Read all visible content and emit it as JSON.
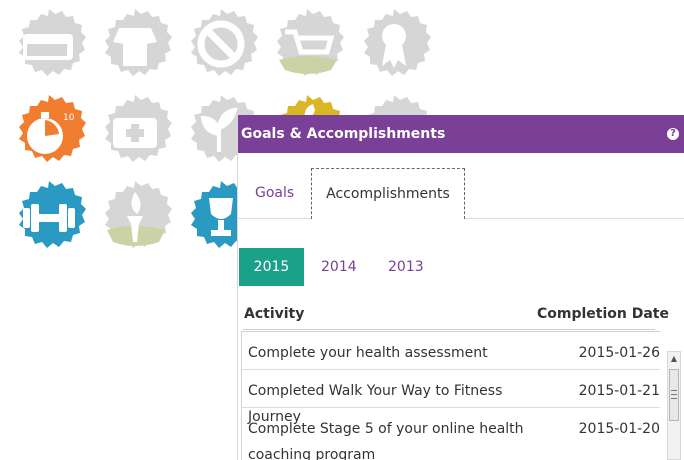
{
  "panel": {
    "title": "Goals & Accomplishments",
    "help": "?",
    "tabs": [
      {
        "label": "Goals"
      },
      {
        "label": "Accomplishments",
        "active": true
      }
    ],
    "years": [
      {
        "label": "2015",
        "active": true
      },
      {
        "label": "2014"
      },
      {
        "label": "2013"
      }
    ],
    "table": {
      "headers": {
        "activity": "Activity",
        "date": "Completion Date"
      },
      "rows": [
        {
          "activity": "Complete your health assessment",
          "date": "2015-01-26"
        },
        {
          "activity": "Completed Walk Your Way to Fitness Journey",
          "date": "2015-01-21"
        },
        {
          "activity": "Complete Stage 5 of your online health coaching program",
          "date": "2015-01-20"
        }
      ]
    }
  },
  "badges": [
    {
      "icon": "tape-measure-icon",
      "color": "#d6d6d6"
    },
    {
      "icon": "chef-icon",
      "color": "#d6d6d6"
    },
    {
      "icon": "no-sign-icon",
      "color": "#d6d6d6"
    },
    {
      "icon": "shopping-cart-icon",
      "color": "#d6d6d6"
    },
    {
      "icon": "ribbon-icon",
      "color": "#d6d6d6"
    },
    {
      "icon": "stopwatch-icon",
      "color": "#f07d30"
    },
    {
      "icon": "first-aid-icon",
      "color": "#d6d6d6"
    },
    {
      "icon": "leaf-icon",
      "color": "#d6d6d6"
    },
    {
      "icon": "moon-icon",
      "color": "#d9b625"
    },
    {
      "icon": "badge-icon",
      "color": "#d6d6d6"
    },
    {
      "icon": "dumbbell-icon",
      "color": "#2b9ac3"
    },
    {
      "icon": "torch-icon",
      "color": "#d6d6d6"
    },
    {
      "icon": "trophy-icon",
      "color": "#2b9ac3"
    }
  ],
  "colors": {
    "accent": "#7a3f97",
    "active_year": "#1aa187"
  }
}
